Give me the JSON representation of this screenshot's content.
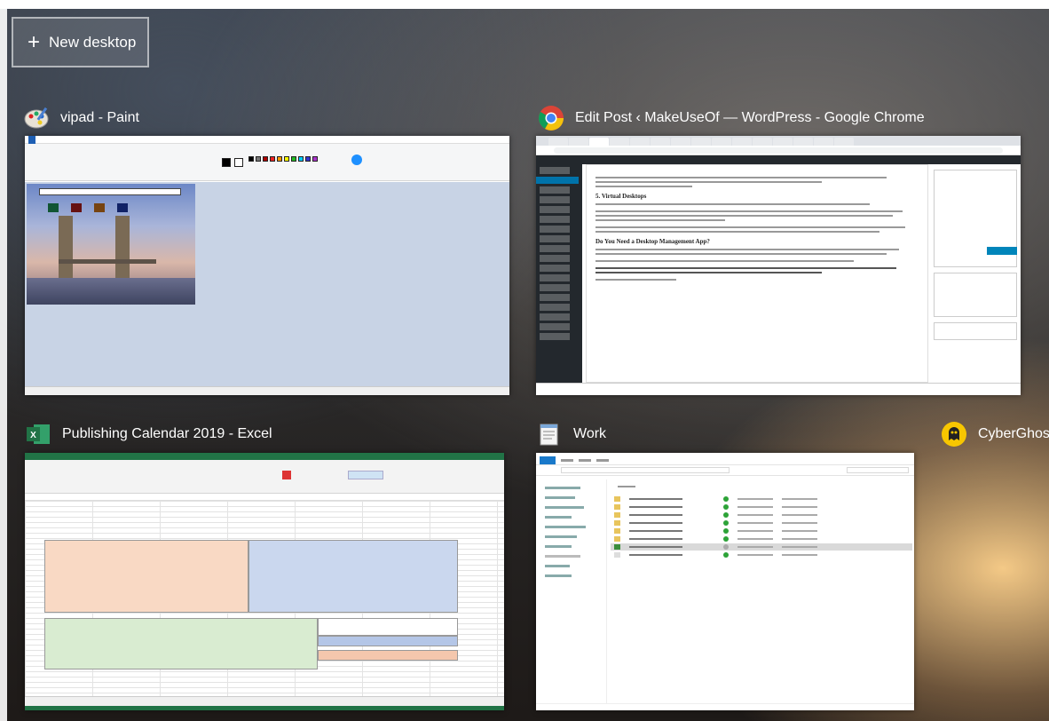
{
  "new_desktop": {
    "label": "New desktop"
  },
  "windows": [
    {
      "title": "vipad - Paint",
      "icon": "paint-palette-icon"
    },
    {
      "title": "Edit Post ‹ MakeUseOf — WordPress - Google Chrome",
      "icon": "chrome-icon"
    },
    {
      "title": "Publishing Calendar 2019 - Excel",
      "icon": "excel-icon"
    },
    {
      "title": "Work",
      "icon": "notepad-icon"
    },
    {
      "title": "CyberGhos",
      "icon": "cyberghost-icon"
    }
  ],
  "chrome_content": {
    "heading_1": "5. Virtual Desktops",
    "heading_2": "Do You Need a Desktop Management App?"
  },
  "colors": {
    "excel_green": "#217346",
    "wordpress_dark": "#23282d",
    "wordpress_blue": "#0085ba",
    "explorer_blue": "#1979ca",
    "cyberghost_yellow": "#f7c600"
  }
}
